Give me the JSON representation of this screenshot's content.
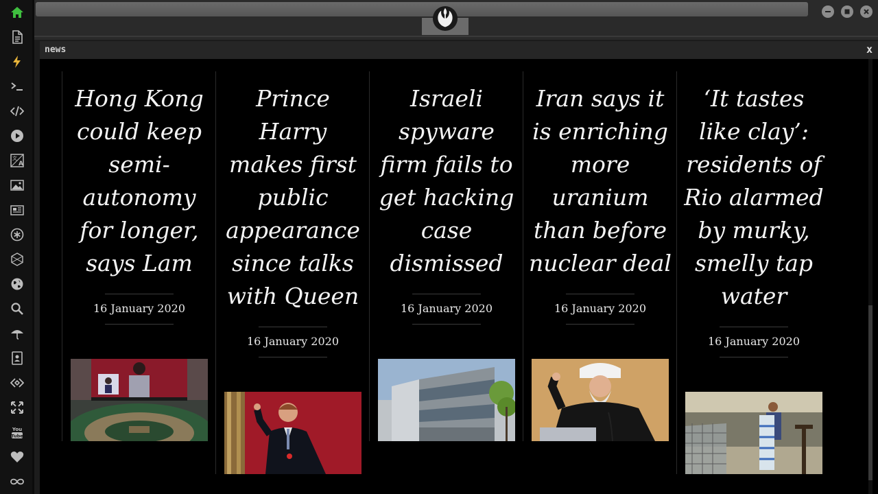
{
  "sidebar": {
    "icons": [
      {
        "name": "home-icon",
        "color": "#3fbf3f"
      },
      {
        "name": "document-icon",
        "color": "#bdbdbd"
      },
      {
        "name": "lightning-icon",
        "color": "#e8b43a"
      },
      {
        "name": "terminal-icon",
        "color": "#bdbdbd"
      },
      {
        "name": "code-icon",
        "color": "#bdbdbd"
      },
      {
        "name": "play-icon",
        "color": "#bdbdbd"
      },
      {
        "name": "translate-icon",
        "color": "#bdbdbd"
      },
      {
        "name": "image-icon",
        "color": "#bdbdbd"
      },
      {
        "name": "newspaper-icon",
        "color": "#bdbdbd"
      },
      {
        "name": "asterisk-icon",
        "color": "#bdbdbd"
      },
      {
        "name": "cube-icon",
        "color": "#bdbdbd"
      },
      {
        "name": "globe-icon",
        "color": "#bdbdbd"
      },
      {
        "name": "search-icon",
        "color": "#bdbdbd"
      },
      {
        "name": "umbrella-icon",
        "color": "#bdbdbd"
      },
      {
        "name": "contact-card-icon",
        "color": "#bdbdbd"
      },
      {
        "name": "exchange-icon",
        "color": "#bdbdbd"
      },
      {
        "name": "expand-icon",
        "color": "#bdbdbd"
      },
      {
        "name": "youtube-icon",
        "color": "#bdbdbd"
      },
      {
        "name": "heart-icon",
        "color": "#bdbdbd"
      },
      {
        "name": "infinity-icon",
        "color": "#bdbdbd"
      }
    ],
    "youtube_text": "You Tube"
  },
  "window": {
    "logo_icon": "rebel-alliance-icon",
    "buttons": [
      "minimize-icon",
      "maximize-icon",
      "close-icon"
    ]
  },
  "panel": {
    "title": "news",
    "close_label": "x"
  },
  "articles": [
    {
      "headline": "Hong Kong could keep semi-autonomy for longer, says Lam",
      "date": "16 January 2020",
      "image": "hong-kong-legislative-council-photo"
    },
    {
      "headline": "Prince Harry makes first public appearance since talks with Queen",
      "date": "16 January 2020",
      "image": "prince-harry-photo"
    },
    {
      "headline": "Israeli spyware firm fails to get hacking case dismissed",
      "date": "16 January 2020",
      "image": "office-building-photo"
    },
    {
      "headline": "Iran says it is enriching more uranium than before nuclear deal",
      "date": "16 January 2020",
      "image": "iran-president-photo"
    },
    {
      "headline": "‘It tastes like clay’: residents of Rio alarmed by murky, smelly tap water",
      "date": "16 January 2020",
      "image": "supermarket-water-bottles-photo"
    }
  ],
  "colors": {
    "background": "#000000",
    "sidebar": "#121212",
    "home_accent": "#3fbf3f",
    "lightning_accent": "#e8b43a",
    "headline": "#f4f4f4"
  }
}
